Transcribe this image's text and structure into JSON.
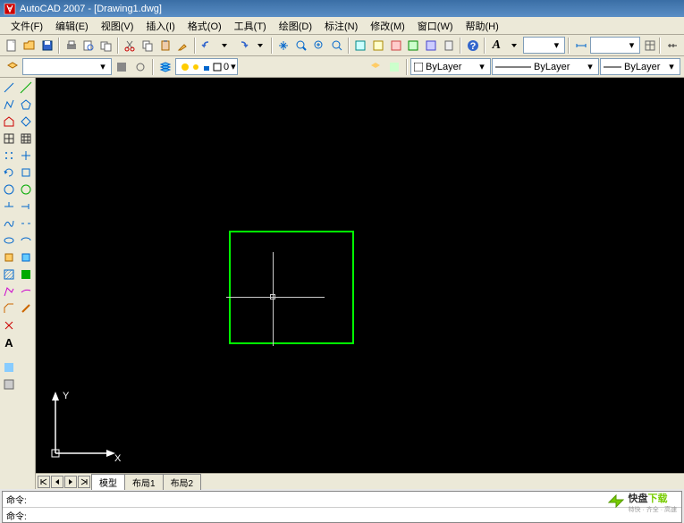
{
  "title": "AutoCAD 2007 - [Drawing1.dwg]",
  "menu": [
    "文件(F)",
    "编辑(E)",
    "视图(V)",
    "插入(I)",
    "格式(O)",
    "工具(T)",
    "绘图(D)",
    "标注(N)",
    "修改(M)",
    "窗口(W)",
    "帮助(H)"
  ],
  "toolbar1_icons": [
    "new",
    "open",
    "save",
    "print",
    "preview",
    "publish",
    "cut",
    "copy",
    "paste",
    "match",
    "undo",
    "redo",
    "pan",
    "zoom-rt",
    "zoom-win",
    "zoom-prev",
    "props",
    "design-center",
    "tool-palette",
    "sheet",
    "markup",
    "calc",
    "help"
  ],
  "font_dd": "",
  "style_dd": "",
  "layer_dd": "0",
  "layer_controls": [
    "freeze",
    "lock",
    "color"
  ],
  "prop_bylayer1": "ByLayer",
  "prop_bylayer2": "ByLayer",
  "prop_bylayer3": "ByLayer",
  "tabs": {
    "nav": [
      "|<",
      "<",
      ">",
      ">|"
    ],
    "items": [
      "模型",
      "布局1",
      "布局2"
    ],
    "active": 0
  },
  "cmd": {
    "line1": "命令:",
    "line2": "命令:"
  },
  "ucs": {
    "x": "X",
    "y": "Y"
  },
  "sidebar_tools": [
    "line",
    "xline",
    "pline",
    "polygon",
    "rect",
    "arc",
    "circle",
    "revcloud",
    "spline",
    "ellipse",
    "ellipse-arc",
    "block",
    "point",
    "hatch",
    "gradient",
    "region",
    "table",
    "mtext",
    "move",
    "copy",
    "rotate",
    "scale",
    "stretch",
    "trim",
    "extend",
    "break",
    "fillet",
    "chamfer",
    "explode"
  ],
  "watermark": {
    "brand": "快盘",
    "sub": "下载"
  }
}
